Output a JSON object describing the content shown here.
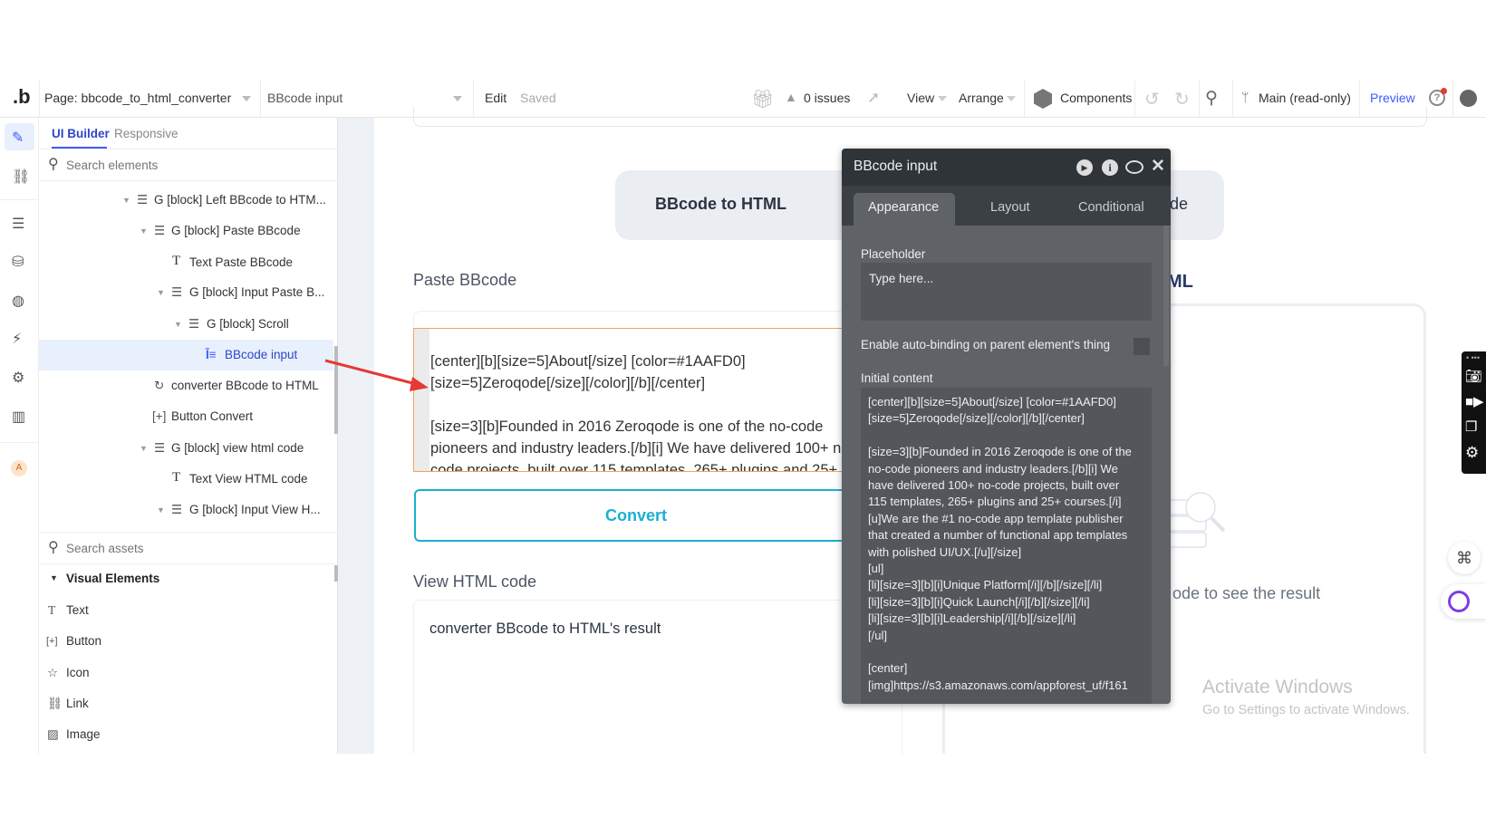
{
  "toolbar": {
    "logo": ".b",
    "page_label": "Page: bbcode_to_html_converter",
    "element_select": "BBcode input",
    "edit": "Edit",
    "saved": "Saved",
    "issues": "0 issues",
    "view": "View",
    "arrange": "Arrange",
    "components": "Components",
    "branch": "Main (read-only)",
    "preview": "Preview"
  },
  "left_panel": {
    "tabs": [
      {
        "label": "UI Builder",
        "active": true
      },
      {
        "label": "Responsive",
        "active": false
      }
    ],
    "search_placeholder": "Search elements",
    "tree": [
      {
        "label": "G [block] Left BBcode to HTM...",
        "icon": "group-icon"
      },
      {
        "label": "G [block] Paste BBcode",
        "icon": "group-icon"
      },
      {
        "label": "Text Paste BBcode",
        "icon": "text-icon"
      },
      {
        "label": "G [block] Input Paste B...",
        "icon": "group-icon"
      },
      {
        "label": "G [block] Scroll",
        "icon": "group-icon"
      },
      {
        "label": "BBcode input",
        "icon": "multiline-input-icon",
        "selected": true
      },
      {
        "label": "converter BBcode to HTML",
        "icon": "refresh-icon"
      },
      {
        "label": "Button Convert",
        "icon": "button-icon"
      },
      {
        "label": "G [block] view html code",
        "icon": "group-icon"
      },
      {
        "label": "Text View HTML code",
        "icon": "text-icon"
      },
      {
        "label": "G [block] Input View H...",
        "icon": "group-icon"
      }
    ],
    "assets_placeholder": "Search assets",
    "visual_elements": "Visual Elements",
    "assets": [
      {
        "label": "Text",
        "icon": "text-icon"
      },
      {
        "label": "Button",
        "icon": "button-icon"
      },
      {
        "label": "Icon",
        "icon": "star-icon"
      },
      {
        "label": "Link",
        "icon": "link-icon"
      },
      {
        "label": "Image",
        "icon": "image-icon"
      }
    ],
    "avatar_letter": "A"
  },
  "canvas": {
    "tab_active": "BBcode to HTML",
    "tab_other_partial": "de",
    "paste_label": "Paste BBcode",
    "input_lines": [
      "[center][b][size=5]About[/size] [color=#1AAFD0]",
      "[size=5]Zeroqode[/size][/color][/b][/center]",
      "",
      "[size=3][b]Founded in 2016 Zeroqode is one of the no-code",
      "pioneers and industry leaders.[/b][i] We have delivered 100+ n",
      "code projects, built over 115 templates, 265+ plugins and 25+"
    ],
    "convert": "Convert",
    "view_label": "View HTML code",
    "result": "converter BBcode to HTML's result",
    "right_title_partial": "ML",
    "empty_hint_partial": "ode to see the result",
    "watermark_title": "Activate Windows",
    "watermark_sub": "Go to Settings to activate Windows."
  },
  "property_panel": {
    "title": "BBcode input",
    "tabs": [
      "Appearance",
      "Layout",
      "Conditional"
    ],
    "active_tab": "Appearance",
    "placeholder_label": "Placeholder",
    "placeholder_value": "Type here...",
    "autobind_label": "Enable auto-binding on parent element's thing",
    "autobind_checked": false,
    "initial_label": "Initial content",
    "initial_lines": [
      "[center][b][size=5]About[/size] [color=#1AAFD0]",
      "[size=5]Zeroqode[/size][/color][/b][/center]",
      "",
      "[size=3][b]Founded in 2016 Zeroqode is one of the",
      "no-code pioneers and industry leaders.[/b][i] We",
      "have delivered 100+ no-code projects, built over",
      "115 templates, 265+ plugins and 25+ courses.[/i]",
      "[u]We are the #1 no-code app template publisher",
      "that created a number of functional app templates",
      "with polished UI/UX.[/u][/size]",
      "[ul]",
      "[li][size=3][b][i]Unique Platform[/i][/b][/size][/li]",
      "[li][size=3][b][i]Quick Launch[/i][/b][/size][/li]",
      "[li][size=3][b][i]Leadership[/i][/b][/size][/li]",
      "[/ul]",
      "",
      "[center]",
      "[img]https://s3.amazonaws.com/appforest_uf/f161"
    ]
  },
  "colors": {
    "accent": "#1AAFD0",
    "selection": "#e8f0fd",
    "link": "#3d5afe",
    "panel": "#5f6367",
    "focus_border": "#f5a35c",
    "arrow": "#e53935"
  }
}
